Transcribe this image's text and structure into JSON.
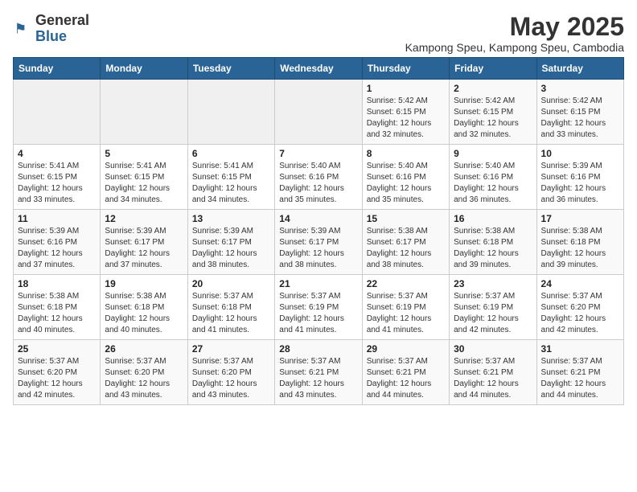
{
  "logo": {
    "general": "General",
    "blue": "Blue"
  },
  "title": "May 2025",
  "subtitle": "Kampong Speu, Kampong Speu, Cambodia",
  "headers": [
    "Sunday",
    "Monday",
    "Tuesday",
    "Wednesday",
    "Thursday",
    "Friday",
    "Saturday"
  ],
  "weeks": [
    [
      {
        "day": "",
        "info": ""
      },
      {
        "day": "",
        "info": ""
      },
      {
        "day": "",
        "info": ""
      },
      {
        "day": "",
        "info": ""
      },
      {
        "day": "1",
        "info": "Sunrise: 5:42 AM\nSunset: 6:15 PM\nDaylight: 12 hours\nand 32 minutes."
      },
      {
        "day": "2",
        "info": "Sunrise: 5:42 AM\nSunset: 6:15 PM\nDaylight: 12 hours\nand 32 minutes."
      },
      {
        "day": "3",
        "info": "Sunrise: 5:42 AM\nSunset: 6:15 PM\nDaylight: 12 hours\nand 33 minutes."
      }
    ],
    [
      {
        "day": "4",
        "info": "Sunrise: 5:41 AM\nSunset: 6:15 PM\nDaylight: 12 hours\nand 33 minutes."
      },
      {
        "day": "5",
        "info": "Sunrise: 5:41 AM\nSunset: 6:15 PM\nDaylight: 12 hours\nand 34 minutes."
      },
      {
        "day": "6",
        "info": "Sunrise: 5:41 AM\nSunset: 6:15 PM\nDaylight: 12 hours\nand 34 minutes."
      },
      {
        "day": "7",
        "info": "Sunrise: 5:40 AM\nSunset: 6:16 PM\nDaylight: 12 hours\nand 35 minutes."
      },
      {
        "day": "8",
        "info": "Sunrise: 5:40 AM\nSunset: 6:16 PM\nDaylight: 12 hours\nand 35 minutes."
      },
      {
        "day": "9",
        "info": "Sunrise: 5:40 AM\nSunset: 6:16 PM\nDaylight: 12 hours\nand 36 minutes."
      },
      {
        "day": "10",
        "info": "Sunrise: 5:39 AM\nSunset: 6:16 PM\nDaylight: 12 hours\nand 36 minutes."
      }
    ],
    [
      {
        "day": "11",
        "info": "Sunrise: 5:39 AM\nSunset: 6:16 PM\nDaylight: 12 hours\nand 37 minutes."
      },
      {
        "day": "12",
        "info": "Sunrise: 5:39 AM\nSunset: 6:17 PM\nDaylight: 12 hours\nand 37 minutes."
      },
      {
        "day": "13",
        "info": "Sunrise: 5:39 AM\nSunset: 6:17 PM\nDaylight: 12 hours\nand 38 minutes."
      },
      {
        "day": "14",
        "info": "Sunrise: 5:39 AM\nSunset: 6:17 PM\nDaylight: 12 hours\nand 38 minutes."
      },
      {
        "day": "15",
        "info": "Sunrise: 5:38 AM\nSunset: 6:17 PM\nDaylight: 12 hours\nand 38 minutes."
      },
      {
        "day": "16",
        "info": "Sunrise: 5:38 AM\nSunset: 6:18 PM\nDaylight: 12 hours\nand 39 minutes."
      },
      {
        "day": "17",
        "info": "Sunrise: 5:38 AM\nSunset: 6:18 PM\nDaylight: 12 hours\nand 39 minutes."
      }
    ],
    [
      {
        "day": "18",
        "info": "Sunrise: 5:38 AM\nSunset: 6:18 PM\nDaylight: 12 hours\nand 40 minutes."
      },
      {
        "day": "19",
        "info": "Sunrise: 5:38 AM\nSunset: 6:18 PM\nDaylight: 12 hours\nand 40 minutes."
      },
      {
        "day": "20",
        "info": "Sunrise: 5:37 AM\nSunset: 6:18 PM\nDaylight: 12 hours\nand 41 minutes."
      },
      {
        "day": "21",
        "info": "Sunrise: 5:37 AM\nSunset: 6:19 PM\nDaylight: 12 hours\nand 41 minutes."
      },
      {
        "day": "22",
        "info": "Sunrise: 5:37 AM\nSunset: 6:19 PM\nDaylight: 12 hours\nand 41 minutes."
      },
      {
        "day": "23",
        "info": "Sunrise: 5:37 AM\nSunset: 6:19 PM\nDaylight: 12 hours\nand 42 minutes."
      },
      {
        "day": "24",
        "info": "Sunrise: 5:37 AM\nSunset: 6:20 PM\nDaylight: 12 hours\nand 42 minutes."
      }
    ],
    [
      {
        "day": "25",
        "info": "Sunrise: 5:37 AM\nSunset: 6:20 PM\nDaylight: 12 hours\nand 42 minutes."
      },
      {
        "day": "26",
        "info": "Sunrise: 5:37 AM\nSunset: 6:20 PM\nDaylight: 12 hours\nand 43 minutes."
      },
      {
        "day": "27",
        "info": "Sunrise: 5:37 AM\nSunset: 6:20 PM\nDaylight: 12 hours\nand 43 minutes."
      },
      {
        "day": "28",
        "info": "Sunrise: 5:37 AM\nSunset: 6:21 PM\nDaylight: 12 hours\nand 43 minutes."
      },
      {
        "day": "29",
        "info": "Sunrise: 5:37 AM\nSunset: 6:21 PM\nDaylight: 12 hours\nand 44 minutes."
      },
      {
        "day": "30",
        "info": "Sunrise: 5:37 AM\nSunset: 6:21 PM\nDaylight: 12 hours\nand 44 minutes."
      },
      {
        "day": "31",
        "info": "Sunrise: 5:37 AM\nSunset: 6:21 PM\nDaylight: 12 hours\nand 44 minutes."
      }
    ]
  ]
}
